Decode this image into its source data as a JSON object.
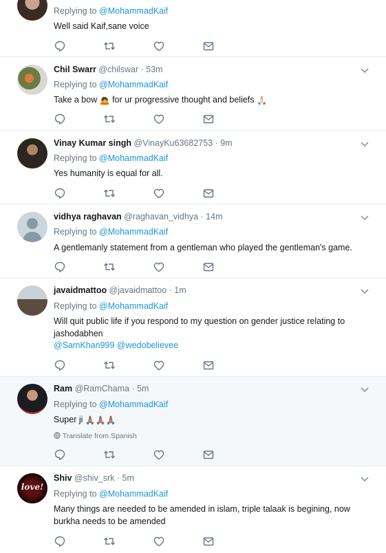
{
  "reply_prefix": "Replying to",
  "tweets": [
    {
      "name": "",
      "handle": "",
      "time": "",
      "reply_to": "@MohammadKaif",
      "text": "Well said Kaif,sane voice",
      "mentions": "",
      "translate": ""
    },
    {
      "name": "Chil Swarr",
      "handle": "@chilswar",
      "time": "· 53m",
      "reply_to": "@MohammadKaif",
      "text_before": "Take a bow ",
      "emoji1": "🙇",
      "text_middle": " for ur progressive thought and beliefs ",
      "emoji2": "🙏🏻"
    },
    {
      "name": "Vinay Kumar singh",
      "handle": "@VinayKu63682753",
      "time": "· 9m",
      "reply_to": "@MohammadKaif",
      "text": "Yes humanity is equal for all."
    },
    {
      "name": "vidhya raghavan",
      "handle": "@raghavan_vidhya",
      "time": "· 14m",
      "reply_to": "@MohammadKaif",
      "text": "A gentlemanly statement from a gentleman who played the gentleman's game."
    },
    {
      "name": "javaidmattoo",
      "handle": "@javaidmattoo",
      "time": "· 1m",
      "reply_to": "@MohammadKaif",
      "text": "Will quit public life if you respond to my question on gender justice relating to jashodabhen",
      "mentions": "@SamKhan999 @wedobelievee"
    },
    {
      "name": "Ram",
      "handle": "@RamChama",
      "time": "· 5m",
      "reply_to": "@MohammadKaif",
      "text": "Super ji ",
      "emoji": "🙏🏽🙏🏽🙏🏽",
      "translate": "Translate from Spanish"
    },
    {
      "name": "Shiv",
      "handle": "@shiv_srk",
      "time": "· 5m",
      "reply_to": "@MohammadKaif",
      "text": "Many things are needed to be amended in islam, triple talaak is begining, now burkha needs to be amended",
      "avatar_text": "love!"
    }
  ],
  "icons": [
    "reply-icon",
    "retweet-icon",
    "like-icon",
    "dm-icon",
    "chevron-down-icon",
    "globe-icon"
  ],
  "colors": {
    "link": "#1b95e0",
    "muted": "#657786",
    "divider": "#e6ecf0",
    "highlight_bg": "#f5f8fa"
  }
}
